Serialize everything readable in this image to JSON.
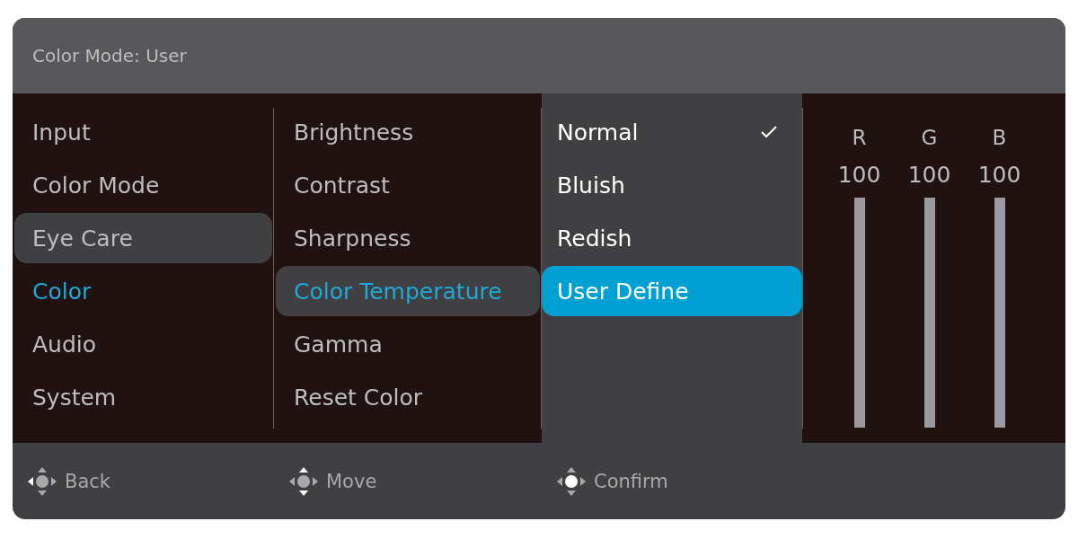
{
  "header": {
    "title": "Color Mode: User"
  },
  "main_menu": [
    {
      "label": "Input",
      "selected": false,
      "highlighted": false
    },
    {
      "label": "Color Mode",
      "selected": false,
      "highlighted": false
    },
    {
      "label": "Eye Care",
      "selected": false,
      "highlighted": true
    },
    {
      "label": "Color",
      "selected": true,
      "highlighted": false
    },
    {
      "label": "Audio",
      "selected": false,
      "highlighted": false
    },
    {
      "label": "System",
      "selected": false,
      "highlighted": false
    }
  ],
  "sub_menu": [
    {
      "label": "Brightness",
      "selected": false,
      "highlighted": false
    },
    {
      "label": "Contrast",
      "selected": false,
      "highlighted": false
    },
    {
      "label": "Sharpness",
      "selected": false,
      "highlighted": false
    },
    {
      "label": "Color Temperature",
      "selected": true,
      "highlighted": true
    },
    {
      "label": "Gamma",
      "selected": false,
      "highlighted": false
    },
    {
      "label": "Reset Color",
      "selected": false,
      "highlighted": false
    }
  ],
  "options": [
    {
      "label": "Normal",
      "checked": true,
      "selected": false
    },
    {
      "label": "Bluish",
      "checked": false,
      "selected": false
    },
    {
      "label": "Redish",
      "checked": false,
      "selected": false
    },
    {
      "label": "User Define",
      "checked": false,
      "selected": true
    }
  ],
  "channels": [
    {
      "name": "R",
      "reading": "100"
    },
    {
      "name": "G",
      "reading": "100"
    },
    {
      "name": "B",
      "reading": "100"
    }
  ],
  "footer": [
    {
      "kind": "back",
      "label": "Back"
    },
    {
      "kind": "move",
      "label": "Move"
    },
    {
      "kind": "confirm",
      "label": "Confirm"
    }
  ]
}
